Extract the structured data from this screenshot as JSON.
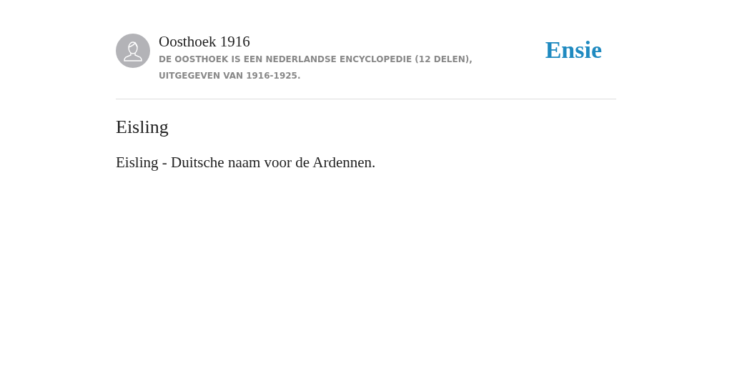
{
  "header": {
    "source_title": "Oosthoek 1916",
    "source_description": "DE OOSTHOEK IS EEN NEDERLANDSE ENCYCLOPEDIE (12 DELEN), UITGEGEVEN VAN 1916-1925.",
    "logo": "Ensie"
  },
  "article": {
    "title": "Eisling",
    "body": "Eisling - Duitsche naam voor de Ardennen."
  }
}
